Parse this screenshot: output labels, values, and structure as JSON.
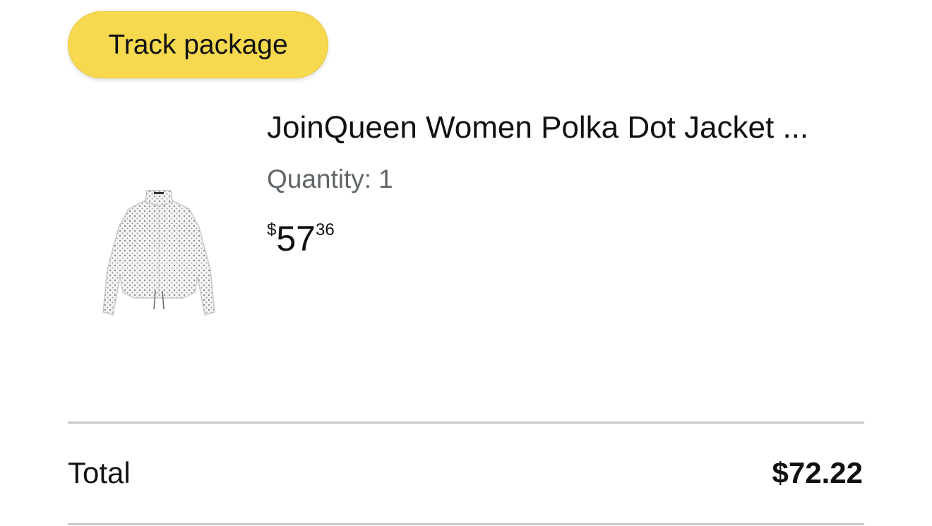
{
  "actions": {
    "track_package_label": "Track package",
    "accent_color": "#f6d94f"
  },
  "item": {
    "title": "JoinQueen Women Polka Dot Jacket ...",
    "quantity_label": "Quantity:",
    "quantity_value": "1",
    "price": {
      "symbol": "$",
      "whole": "57",
      "fraction": "36"
    },
    "image_icon": "polka-dot-jacket-image"
  },
  "summary": {
    "total_label": "Total",
    "total_value": "$72.22"
  }
}
